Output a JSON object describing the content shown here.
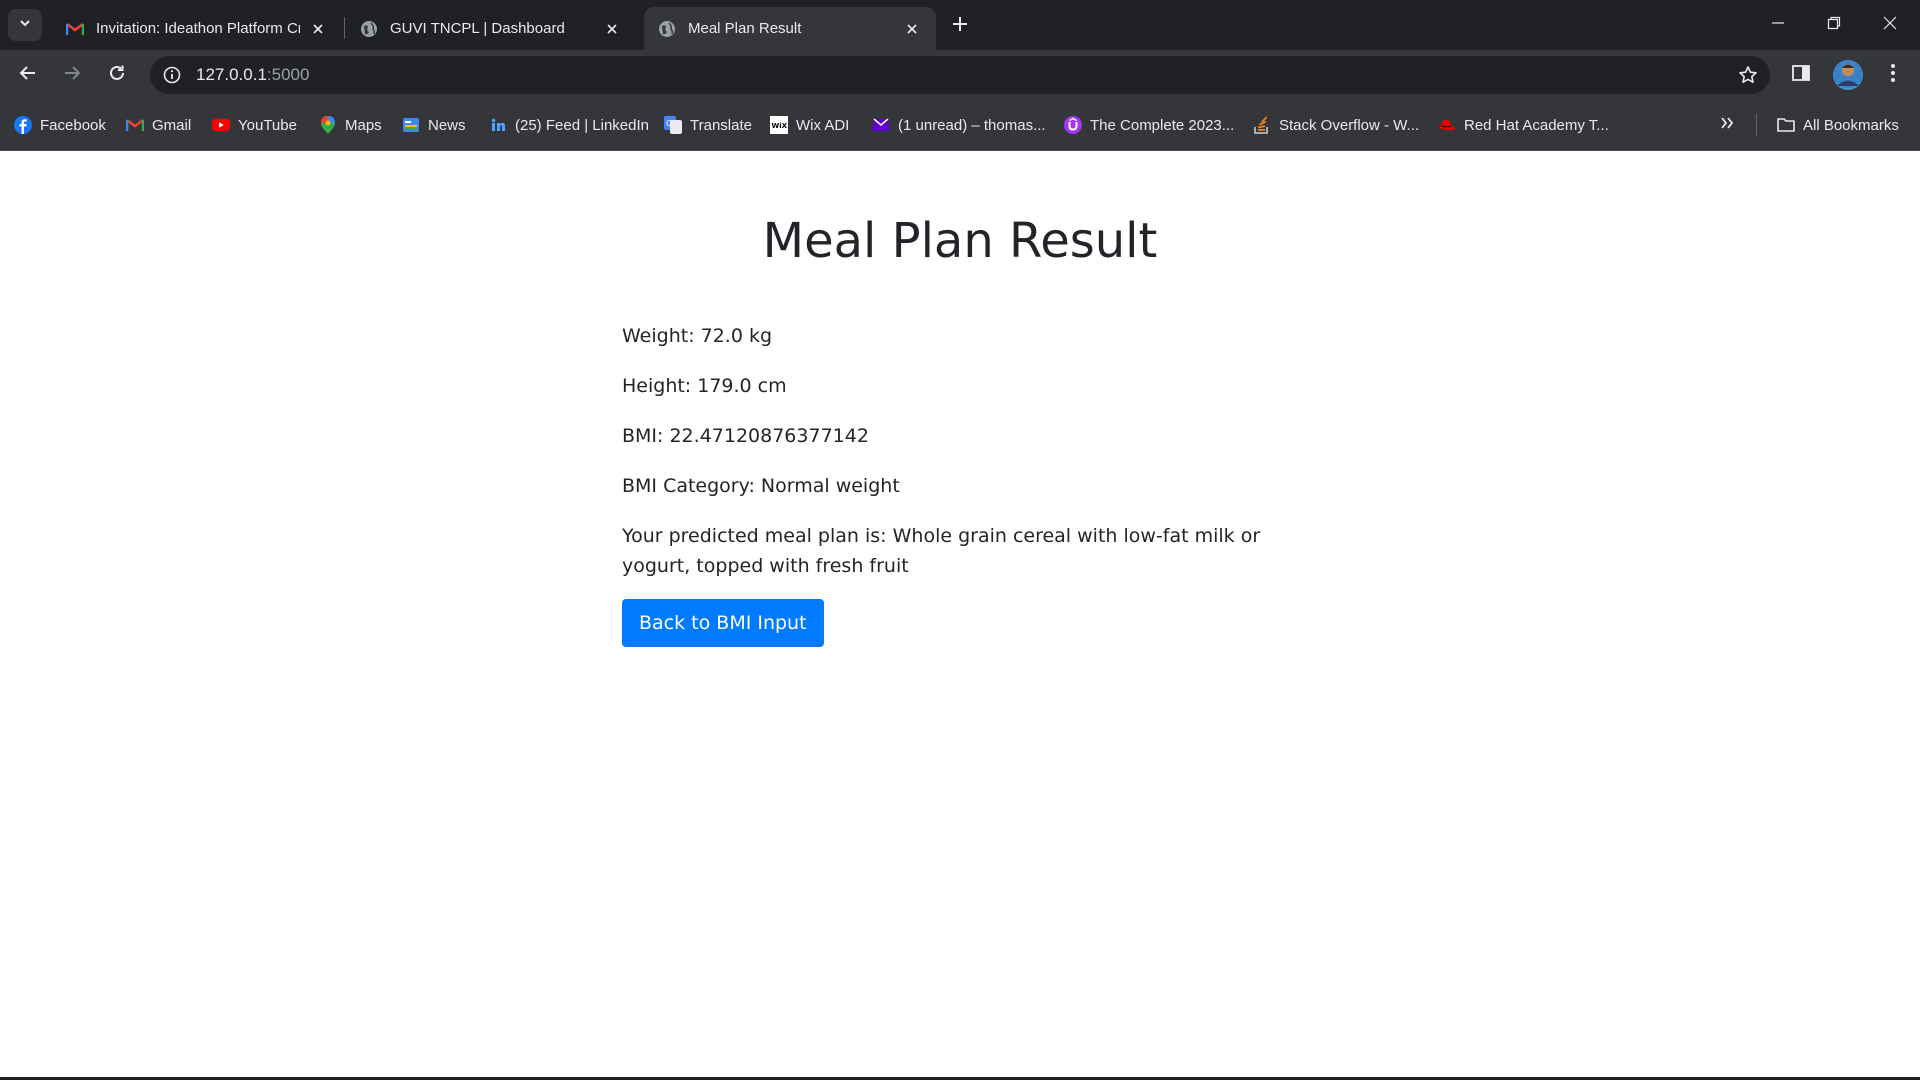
{
  "browser": {
    "tabs": [
      {
        "title": "Invitation: Ideathon Platform Cr",
        "icon": "gmail-icon"
      },
      {
        "title": "GUVI TNCPL | Dashboard",
        "icon": "globe-icon"
      },
      {
        "title": "Meal Plan Result",
        "icon": "globe-icon",
        "active": true
      }
    ],
    "url_host": "127.0.0.1",
    "url_port": ":5000",
    "bookmarks": [
      {
        "label": "Facebook",
        "icon": "facebook-icon"
      },
      {
        "label": "Gmail",
        "icon": "gmail-icon"
      },
      {
        "label": "YouTube",
        "icon": "youtube-icon"
      },
      {
        "label": "Maps",
        "icon": "maps-icon"
      },
      {
        "label": "News",
        "icon": "news-icon"
      },
      {
        "label": "(25) Feed | LinkedIn",
        "icon": "linkedin-icon"
      },
      {
        "label": "Translate",
        "icon": "translate-icon"
      },
      {
        "label": "Wix ADI",
        "icon": "wix-icon"
      },
      {
        "label": "(1 unread) – thomas...",
        "icon": "yahoo-mail-icon"
      },
      {
        "label": "The Complete 2023...",
        "icon": "udemy-icon"
      },
      {
        "label": "Stack Overflow - W...",
        "icon": "stackoverflow-icon"
      },
      {
        "label": "Red Hat Academy T...",
        "icon": "redhat-icon"
      }
    ],
    "all_bookmarks_label": "All Bookmarks"
  },
  "page": {
    "title": "Meal Plan Result",
    "weight": "Weight: 72.0 kg",
    "height": "Height: 179.0 cm",
    "bmi": "BMI: 22.47120876377142",
    "bmi_category": "BMI Category: Normal weight",
    "meal_plan": "Your predicted meal plan is: Whole grain cereal with low-fat milk or yogurt, topped with fresh fruit",
    "back_button": "Back to BMI Input",
    "accent_color": "#007bff"
  }
}
